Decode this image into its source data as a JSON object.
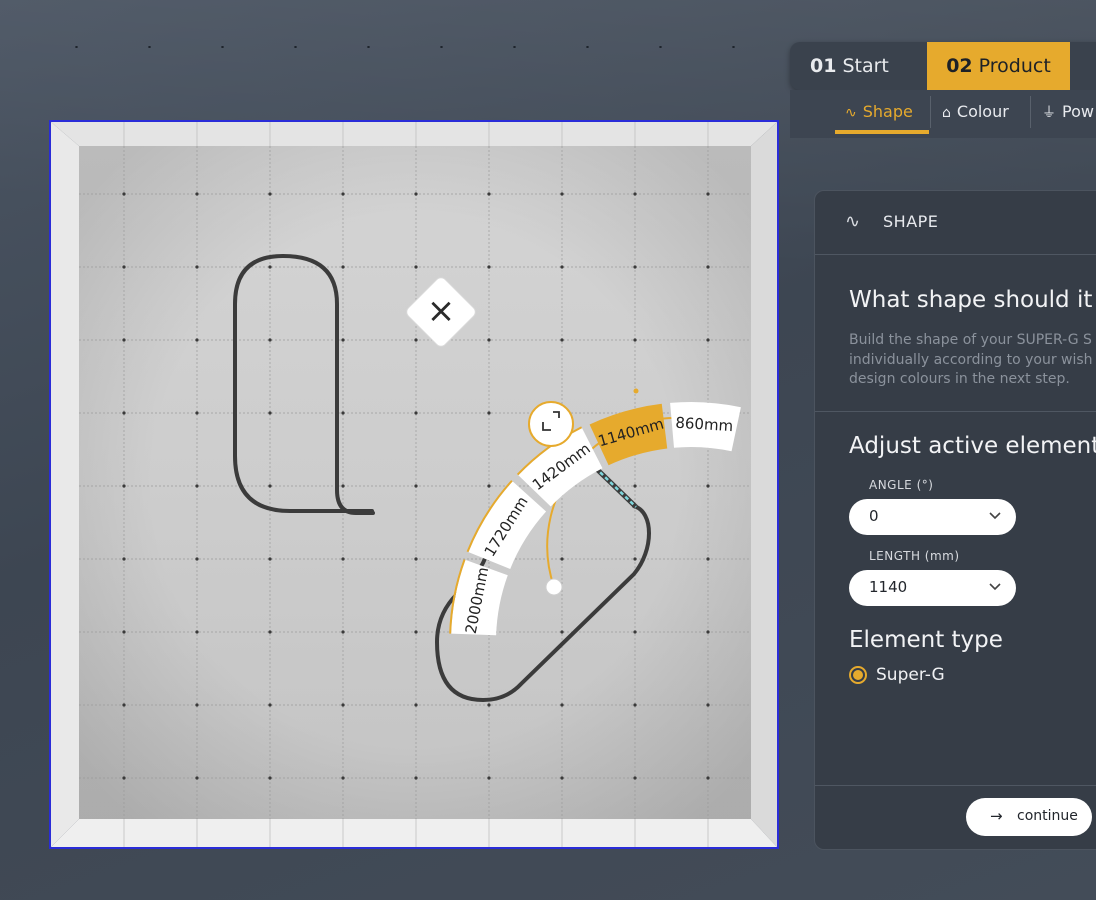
{
  "steps": [
    {
      "num": "01",
      "label": "Start"
    },
    {
      "num": "02",
      "label": "Product"
    }
  ],
  "subtabs": [
    {
      "label": "Shape",
      "icon": "shape-icon"
    },
    {
      "label": "Colour",
      "icon": "colour-icon"
    },
    {
      "label": "Pow",
      "icon": "power-icon"
    }
  ],
  "canvas": {
    "close_symbol": "×",
    "lengths": [
      "2000mm",
      "1720mm",
      "1420mm",
      "1140mm",
      "860mm"
    ],
    "selected_length": "1140mm"
  },
  "panel": {
    "header": "SHAPE",
    "question": "What shape should it b",
    "description": [
      "Build the shape of your SUPER-G S",
      "individually according to your wish",
      "design colours in the next step."
    ],
    "adjust_title": "Adjust active element",
    "angle_label": "ANGLE (°)",
    "angle_value": "0",
    "length_label": "LENGTH (mm)",
    "length_value": "1140",
    "element_type_title": "Element type",
    "element_type_option": "Super-G",
    "continue_label": "continue",
    "continue_arrow": "→"
  },
  "colors": {
    "accent": "#e6aa2d",
    "panel": "#363d47",
    "selection_frame": "#2a2cd8",
    "track": "#3b3b3b",
    "active_segment": "#7fd6dc"
  }
}
